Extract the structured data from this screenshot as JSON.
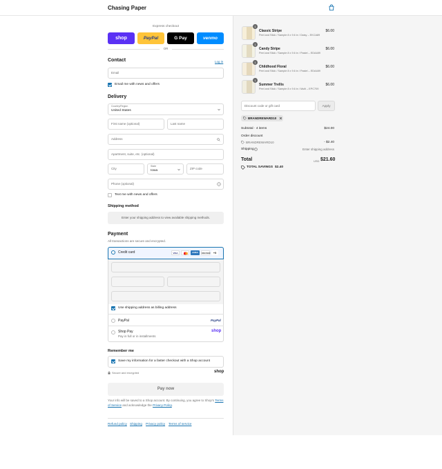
{
  "header": {
    "brand": "Chasing Paper",
    "cart_icon": "bag-icon"
  },
  "express": {
    "label": "Express checkout",
    "buttons": [
      {
        "label": "shop",
        "color": "#5a31f4"
      },
      {
        "label": "PayPal",
        "color": "#ffc439"
      },
      {
        "label": "G Pay",
        "color": "#000000"
      },
      {
        "label": "venmo",
        "color": "#008cff"
      }
    ],
    "divider": "OR"
  },
  "contact": {
    "title": "Contact",
    "login_link": "Log in",
    "email_placeholder": "Email",
    "news_label": "Email me with news and offers"
  },
  "delivery": {
    "title": "Delivery",
    "country_label": "Country/Region",
    "country_value": "United States",
    "first_name": "First name (optional)",
    "last_name": "Last name",
    "address": "Address",
    "apartment": "Apartment, suite, etc. (optional)",
    "city": "City",
    "state_label": "State",
    "state_value": "Iowa",
    "zip": "ZIP code",
    "phone": "Phone (optional)",
    "text_label": "Text me with news and offers"
  },
  "shipping_method": {
    "title": "Shipping method",
    "info": "Enter your shipping address to view available shipping methods."
  },
  "payment": {
    "title": "Payment",
    "subtitle": "All transactions are secure and encrypted.",
    "credit_card_label": "Credit card",
    "card_brands": [
      "VISA",
      "MC",
      "AMEX",
      "DISCOVER",
      "+5"
    ],
    "billing_label": "Use shipping address as billing address",
    "paypal_label": "PayPal",
    "paypal_logo": "PayPal",
    "shoppay_label": "Shop Pay",
    "shoppay_sub": "Pay in full or in installments",
    "shoppay_logo": "shop"
  },
  "remember": {
    "title": "Remember me",
    "save_label": "Save my information for a faster checkout with a Shop account",
    "secure_label": "Secure and encrypted",
    "shop_logo": "shop"
  },
  "pay_now": "Pay now",
  "legal": {
    "text_before": "Your info will be saved to a Shop account. By continuing, you agree to Shop's",
    "tos": "Terms of Service",
    "and": "and acknowledge the",
    "privacy": "Privacy Policy",
    "period": "."
  },
  "footer_links": [
    "Refund policy",
    "Shipping",
    "Privacy policy",
    "Terms of service"
  ],
  "cart": {
    "items": [
      {
        "qty": "1",
        "name": "Classic Stripe",
        "desc": "Peel and Stick / Sample 8 x 9.6 in / Daisy – EKCA89",
        "price": "$6.00"
      },
      {
        "qty": "1",
        "name": "Candy Stripe",
        "desc": "Peel and Stick / Sample 8 x 9.6 in / Pastel – EDA489",
        "price": "$6.00"
      },
      {
        "qty": "1",
        "name": "Childhood Floral",
        "desc": "Peel and Stick / Sample 8 x 9.6 in / Pastel – EDA489",
        "price": "$6.00"
      },
      {
        "qty": "1",
        "name": "Summer Trellis",
        "desc": "Peel and Stick / Sample 8 x 9.6 in / Multi – EPC709",
        "price": "$6.00"
      }
    ],
    "discount_placeholder": "Discount code or gift card",
    "apply": "Apply",
    "code_tag": "BRANDREWARD10",
    "subtotal_label": "Subtotal · 4 items",
    "subtotal_value": "$24.00",
    "order_discount_label": "Order discount",
    "discount_code": "BRANDREWARD10",
    "discount_value": "- $2.40",
    "shipping_label": "Shipping",
    "shipping_value": "Enter shipping address",
    "total_label": "Total",
    "currency": "USD",
    "total_value": "$21.60",
    "savings_label": "TOTAL SAVINGS",
    "savings_value": "$2.40"
  },
  "colors": {
    "accent": "#1773b0",
    "shop_purple": "#5a31f4"
  }
}
